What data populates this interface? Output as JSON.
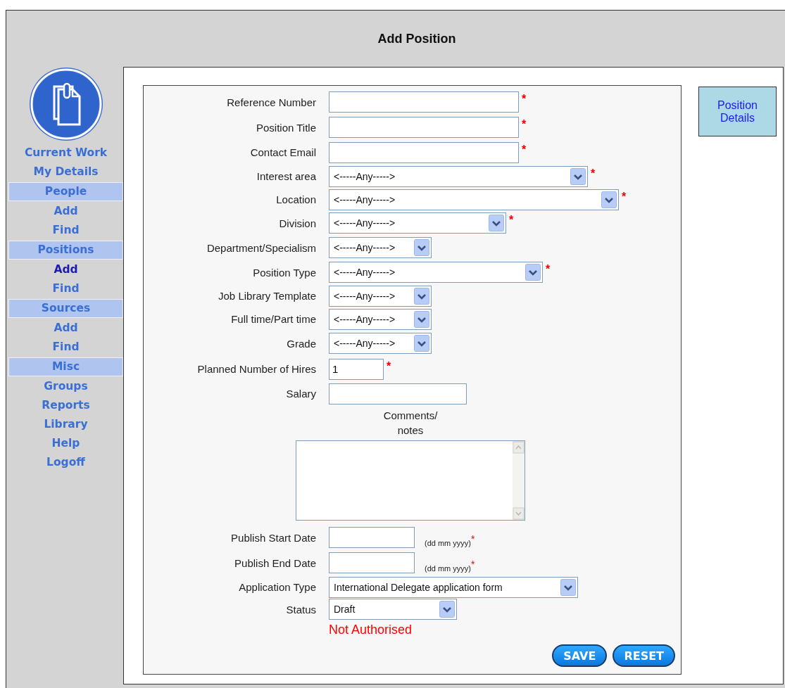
{
  "window": {
    "title": "Add Position"
  },
  "sidebar": {
    "items": [
      {
        "label": "Current Work",
        "kind": "link",
        "selected": false
      },
      {
        "label": "My Details",
        "kind": "link",
        "selected": false
      },
      {
        "label": "People",
        "kind": "header"
      },
      {
        "label": "Add",
        "kind": "link",
        "selected": false
      },
      {
        "label": "Find",
        "kind": "link",
        "selected": false
      },
      {
        "label": "Positions",
        "kind": "header"
      },
      {
        "label": "Add",
        "kind": "link",
        "selected": true
      },
      {
        "label": "Find",
        "kind": "link",
        "selected": false
      },
      {
        "label": "Sources",
        "kind": "header"
      },
      {
        "label": "Add",
        "kind": "link",
        "selected": false
      },
      {
        "label": "Find",
        "kind": "link",
        "selected": false
      },
      {
        "label": "Misc",
        "kind": "header"
      },
      {
        "label": "Groups",
        "kind": "link",
        "selected": false
      },
      {
        "label": "Reports",
        "kind": "link",
        "selected": false
      },
      {
        "label": "Library",
        "kind": "link",
        "selected": false
      },
      {
        "label": "Help",
        "kind": "link",
        "selected": false
      },
      {
        "label": "Logoff",
        "kind": "link",
        "selected": false
      }
    ]
  },
  "form": {
    "fields": [
      {
        "label": "Reference Number",
        "kind": "text",
        "required_mark": "*"
      },
      {
        "label": "Position Title",
        "kind": "text",
        "required_mark": "*"
      },
      {
        "label": "Contact Email",
        "kind": "text",
        "required_mark": "*"
      },
      {
        "label": "Interest area",
        "kind": "select",
        "value": "<-----Any----->",
        "required_mark": "*"
      },
      {
        "label": "Location",
        "kind": "select",
        "value": "<-----Any----->",
        "required_mark": "*"
      },
      {
        "label": "Division",
        "kind": "select",
        "value": "<-----Any----->",
        "required_mark": "*"
      },
      {
        "label": "Department/Specialism",
        "kind": "select",
        "value": "<-----Any----->"
      },
      {
        "label": "Position Type",
        "kind": "select",
        "value": "<-----Any----->",
        "required_mark": "*"
      },
      {
        "label": "Job Library Template",
        "kind": "select",
        "value": "<-----Any----->"
      },
      {
        "label": "Full time/Part time",
        "kind": "select",
        "value": "<-----Any----->"
      },
      {
        "label": "Grade",
        "kind": "select",
        "value": "<-----Any----->"
      },
      {
        "label": "Planned Number of Hires",
        "kind": "text",
        "value": "1",
        "required_mark": "*"
      },
      {
        "label": "Salary",
        "kind": "text"
      },
      {
        "label": "Comments/\nnotes",
        "kind": "textarea"
      },
      {
        "label": "Publish Start Date",
        "kind": "text",
        "hint": "(dd mm yyyy)",
        "required_mark": "*"
      },
      {
        "label": "Publish End Date",
        "kind": "text",
        "hint": "(dd mm yyyy)",
        "required_mark": "*"
      },
      {
        "label": "Application Type",
        "kind": "select",
        "value": "International Delegate application form"
      },
      {
        "label": "Status",
        "kind": "select",
        "value": "Draft"
      }
    ],
    "status_message": "Not Authorised",
    "buttons": [
      "SAVE",
      "RESET"
    ]
  },
  "side_tabs": [
    {
      "label": "Position Details",
      "selected": true
    }
  ]
}
